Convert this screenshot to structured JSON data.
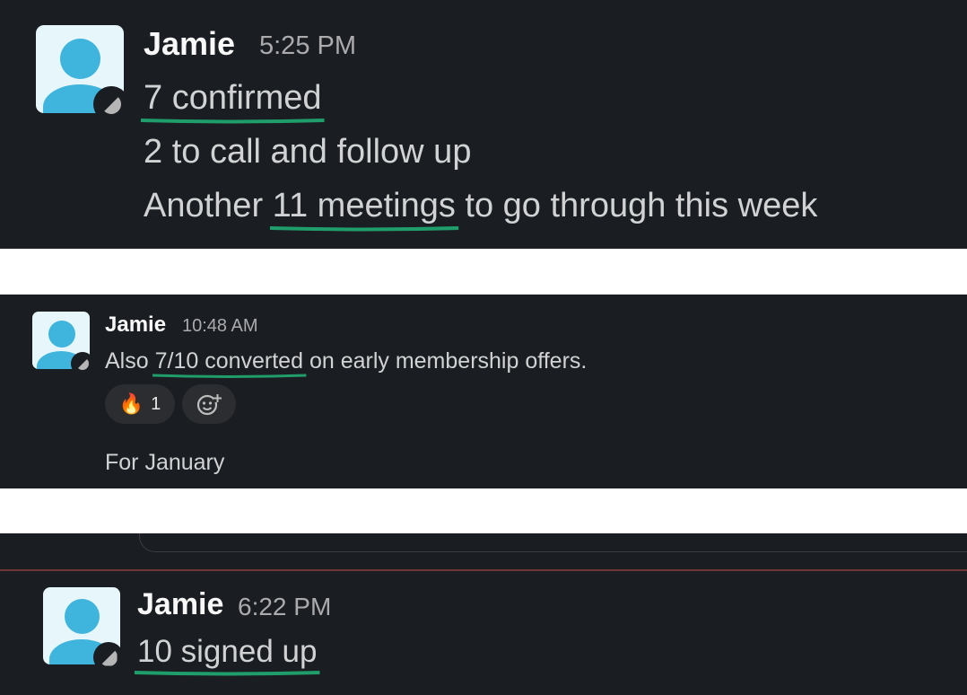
{
  "messages": [
    {
      "author": "Jamie",
      "time": "5:25 PM",
      "lines": [
        {
          "before": "",
          "highlight": "7 confirmed",
          "after": ""
        },
        {
          "before": "2 to call and follow up",
          "highlight": "",
          "after": ""
        },
        {
          "before": "Another ",
          "highlight": "11 meetings",
          "after": " to go through this week"
        }
      ]
    },
    {
      "author": "Jamie",
      "time": "10:48 AM",
      "line": {
        "before": "Also ",
        "highlight": "7/10 converted",
        "after": " on early membership offers."
      },
      "reactions": [
        {
          "emoji": "🔥",
          "count": "1"
        }
      ],
      "add_reaction_icon": "add-reaction-icon",
      "followup": "For January"
    },
    {
      "author": "Jamie",
      "time": "6:22 PM",
      "line": {
        "highlight": "10 signed up"
      }
    }
  ],
  "colors": {
    "background": "#1a1d21",
    "text": "#d1d2d3",
    "author": "#f8f8f8",
    "timestamp": "#ababad",
    "highlight_underline": "#1f9d6b",
    "avatar_bg": "#e7f6fb",
    "avatar_fg": "#3fb5dd",
    "divider": "#6e3636"
  }
}
